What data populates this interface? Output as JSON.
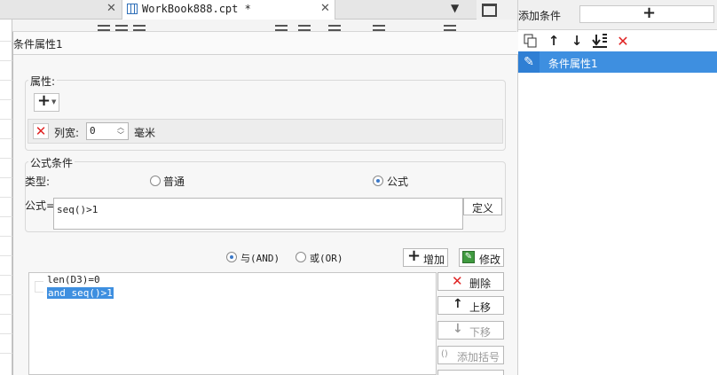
{
  "tabs": {
    "active_label": "WorkBook888.cpt *"
  },
  "right_panel": {
    "add_condition_label": "添加条件",
    "add_button_symbol": "+",
    "items": [
      {
        "label": "条件属性1",
        "selected": true
      }
    ]
  },
  "dialog": {
    "title": "条件属性1",
    "attribute_group": {
      "title": "属性:",
      "add_symbol": "+",
      "row": {
        "label": "列宽:",
        "value": "0",
        "unit": "毫米"
      }
    },
    "formula_group": {
      "title": "公式条件",
      "type_label": "类型:",
      "type_options": [
        {
          "label": "普通",
          "selected": false
        },
        {
          "label": "公式",
          "selected": true
        }
      ],
      "formula_label": "公式=",
      "formula_value": "seq()>1",
      "define_button": "定义"
    },
    "logic_options": [
      {
        "label": "与(AND)",
        "selected": true
      },
      {
        "label": "或(OR)",
        "selected": false
      }
    ],
    "add_button": "增加",
    "modify_button": "修改",
    "conditions": [
      {
        "text": "len(D3)=0",
        "selected": false
      },
      {
        "text": "and seq()>1",
        "selected": true
      }
    ],
    "delete_button": "删除",
    "move_up_button": "上移",
    "move_down_button": "下移",
    "add_bracket_button": "添加括号"
  },
  "colors": {
    "selection": "#3e8fe0",
    "delete_red": "#e02424"
  }
}
